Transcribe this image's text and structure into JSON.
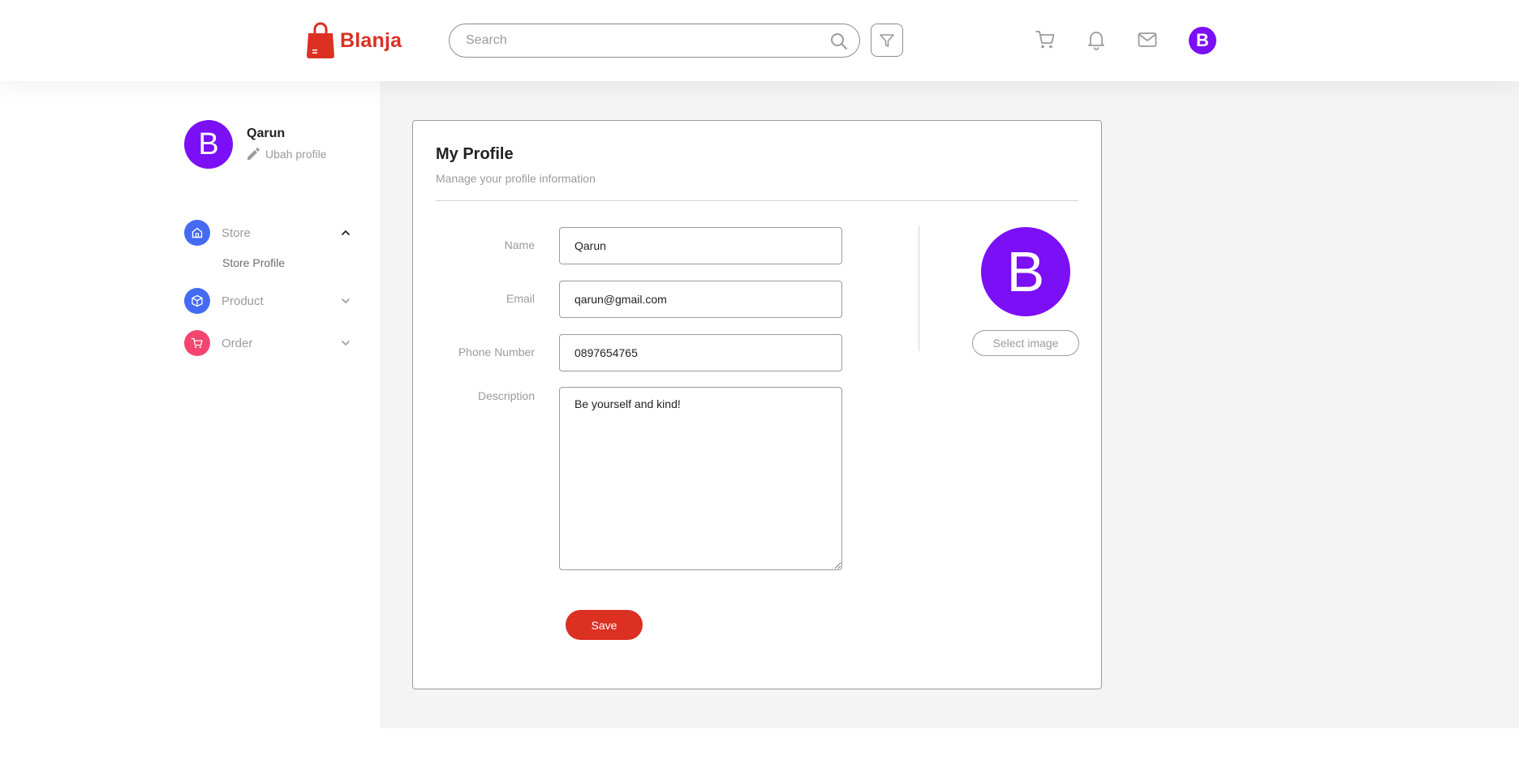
{
  "header": {
    "brand": "Blanja",
    "search_placeholder": "Search",
    "icons": [
      "search-icon",
      "filter-icon",
      "cart-icon",
      "bell-icon",
      "mail-icon"
    ],
    "avatar_letter": "B"
  },
  "sidebar": {
    "user_name": "Qarun",
    "edit_label": "Ubah profile",
    "avatar_letter": "B",
    "menu": [
      {
        "label": "Store",
        "icon": "home-icon",
        "color": "#456bf3",
        "expanded": true
      },
      {
        "label": "Product",
        "icon": "box-icon",
        "color": "#456bf3",
        "expanded": false
      },
      {
        "label": "Order",
        "icon": "cart-icon",
        "color": "#f3456f",
        "expanded": false
      }
    ],
    "submenu": {
      "store_profile": "Store Profile"
    }
  },
  "profile_form": {
    "title": "My Profile",
    "subtitle": "Manage your profile information",
    "name_label": "Name",
    "name_value": "Qarun",
    "email_label": "Email",
    "email_value": "qarun@gmail.com",
    "phone_label": "Phone Number",
    "phone_value": "0897654765",
    "description_label": "Description",
    "description_value": "Be yourself and kind!",
    "save_label": "Save",
    "avatar_letter": "B",
    "select_image_label": "Select image"
  },
  "colors": {
    "brand": "#db3022",
    "avatar": "#7b0ff5",
    "store": "#456bf3",
    "order": "#f3456f"
  }
}
